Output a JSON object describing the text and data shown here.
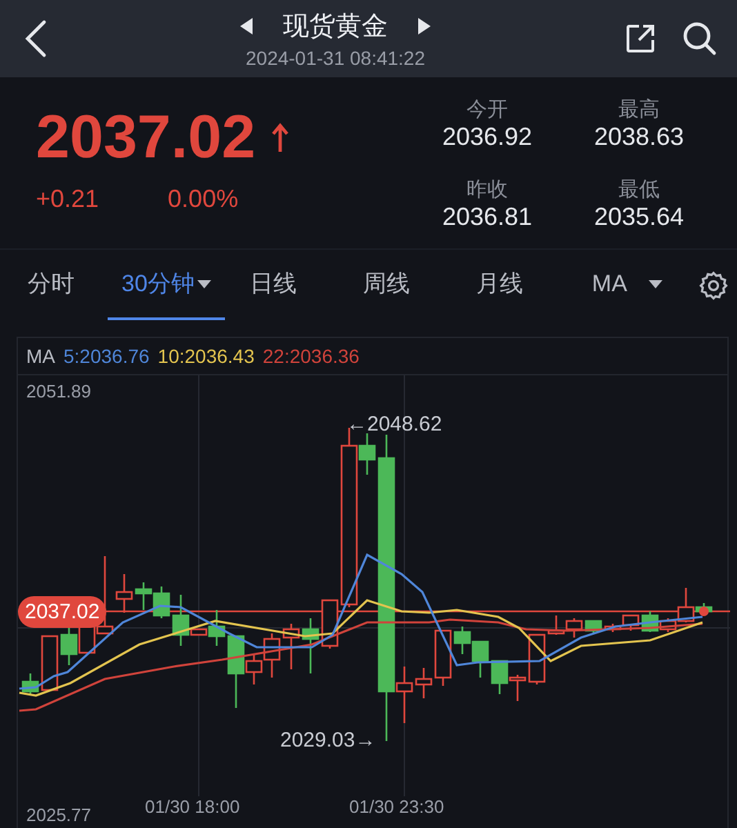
{
  "header": {
    "title": "现货黄金",
    "datetime": "2024-01-31 08:41:22"
  },
  "quote": {
    "price": "2037.02",
    "rising": true,
    "change": "+0.21",
    "change_pct": "0.00%"
  },
  "stats": [
    {
      "label": "今开",
      "value": "2036.92"
    },
    {
      "label": "最高",
      "value": "2038.63"
    },
    {
      "label": "昨收",
      "value": "2036.81"
    },
    {
      "label": "最低",
      "value": "2035.64"
    }
  ],
  "tabs": [
    {
      "label": "分时",
      "selected": false,
      "dropdown": false
    },
    {
      "label": "30分钟",
      "selected": true,
      "dropdown": true
    },
    {
      "label": "日线",
      "selected": false,
      "dropdown": false
    },
    {
      "label": "周线",
      "selected": false,
      "dropdown": false
    },
    {
      "label": "月线",
      "selected": false,
      "dropdown": false
    },
    {
      "label": "MA",
      "selected": false,
      "dropdown": true
    }
  ],
  "ma_legend": {
    "label": "MA",
    "items": [
      {
        "text": "5:2036.76",
        "color": "#4f86d9"
      },
      {
        "text": "10:2036.43",
        "color": "#e3c44f"
      },
      {
        "text": "22:2036.36",
        "color": "#d0433b"
      }
    ]
  },
  "chart": {
    "y_max_label": "2051.89",
    "y_min_label": "2025.77",
    "x_labels": [
      "01/30 18:00",
      "01/30 23:30"
    ],
    "high_label": "←2048.62",
    "low_label": "2029.03→",
    "last_price_badge": "2037.02"
  }
}
